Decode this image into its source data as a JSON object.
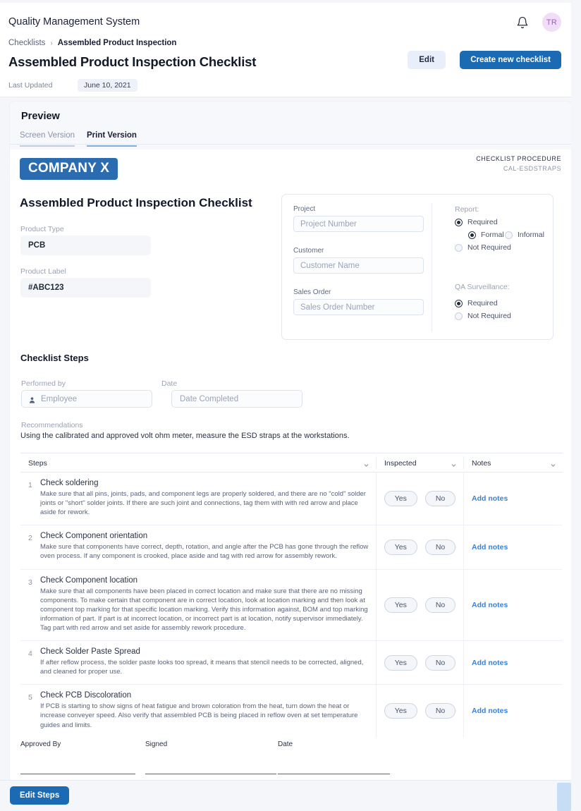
{
  "appbar": {
    "title": "Quality Management System",
    "bell_icon": "bell-icon",
    "avatar_initials": "TR"
  },
  "breadcrumb": {
    "parent": "Checklists",
    "separator": "›",
    "current": "Assembled Product Inspection"
  },
  "header": {
    "page_title": "Assembled Product Inspection Checklist",
    "edit_label": "Edit",
    "create_label": "Create new checklist",
    "last_updated_label": "Last Updated",
    "last_updated_value": "June 10, 2021"
  },
  "preview": {
    "heading": "Preview",
    "tabs": [
      {
        "label": "Screen Version",
        "active": false
      },
      {
        "label": "Print Version",
        "active": true
      }
    ]
  },
  "document": {
    "company_logo": "COMPANY X",
    "procedure_label": "CHECKLIST PROCEDURE",
    "procedure_code": "CAL-ESDSTRAPS",
    "title": "Assembled Product Inspection Checklist",
    "product_type_label": "Product Type",
    "product_type_value": "PCB",
    "product_label_label": "Product Label",
    "product_label_value": "#ABC123"
  },
  "infocard": {
    "project_label": "Project",
    "project_placeholder": "Project Number",
    "project_value": "",
    "customer_label": "Customer",
    "customer_placeholder": "Customer Name",
    "customer_value": "",
    "sales_order_label": "Sales Order",
    "sales_order_placeholder": "Sales Order Number",
    "sales_order_value": "",
    "report_title": "Report:",
    "report_required": "Required",
    "report_formal": "Formal",
    "report_informal": "Informal",
    "report_not_required": "Not Required",
    "qa_title": "QA Surveillance:",
    "qa_required": "Required",
    "qa_not_required": "Not Required"
  },
  "steps_section": {
    "heading": "Checklist Steps",
    "performed_by_label": "Performed by",
    "performed_by_placeholder": "Employee",
    "performed_by_value": "",
    "date_label": "Date",
    "date_placeholder": "Date Completed",
    "date_value": "",
    "recommendations_label": "Recommendations",
    "recommendations_text": "Using the calibrated and approved volt ohm meter, measure the ESD straps at the workstations."
  },
  "table": {
    "columns": [
      "Steps",
      "Inspected",
      "Notes"
    ],
    "yes_label": "Yes",
    "no_label": "No",
    "notes_label": "Add notes",
    "rows": [
      {
        "num": "1",
        "title": "Check soldering",
        "desc": "Make sure that all pins, joints, pads, and component legs are properly soldered, and there are no \"cold\" solder joints or \"short\" solder joints. If there are such joint and connections, tag them with with red arrow and place aside for rework."
      },
      {
        "num": "2",
        "title": "Check Component orientation",
        "desc": "Make sure that components have correct, depth, rotation, and angle after the PCB has gone through the reflow oven process. If any component is crooked, place aside and tag with red arrow for assembly rework."
      },
      {
        "num": "3",
        "title": "Check Component location",
        "desc": "Make sure that all components have been placed in correct location and make sure that there are no missing components. To make certain that component are in correct location, look at location marking and then look at component top marking for that specific location marking. Verify this information against, BOM and top marking information of part. If part is at incorrect location, or incorrect part is at location, notify supervisor immediately. Tag part with red arrow and set aside for assembly rework procedure."
      },
      {
        "num": "4",
        "title": "Check Solder Paste Spread",
        "desc": "If after reflow process, the solder paste looks too spread, it means that stencil needs to be corrected, aligned, and cleaned for proper use."
      },
      {
        "num": "5",
        "title": "Check PCB Discoloration",
        "desc": "If PCB is starting to show signs of heat fatigue and brown coloration from the heat, turn down the heat or increase conveyer speed. Also verify that assembled PCB is being placed in reflow oven at set temperature guides and limits."
      }
    ]
  },
  "signatures": {
    "approved_by": "Approved By",
    "signed": "Signed",
    "date": "Date"
  },
  "bottombar": {
    "edit_steps_label": "Edit Steps"
  },
  "colors": {
    "primary": "#1b6ab4",
    "logo": "#2b6cb0",
    "link": "#3b82d6",
    "avatar_bg": "#f0ddf7",
    "avatar_fg": "#a05fc0",
    "page_bg": "#f4f6fa"
  }
}
